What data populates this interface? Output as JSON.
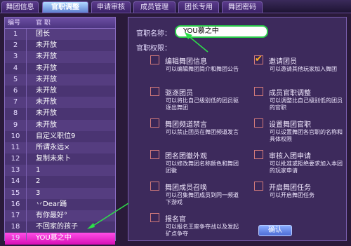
{
  "tabs": [
    {
      "label": "舞团信息"
    },
    {
      "label": "官职调整"
    },
    {
      "label": "申请审核"
    },
    {
      "label": "成员管理"
    },
    {
      "label": "团长专用"
    },
    {
      "label": "舞团密码"
    }
  ],
  "list": {
    "header_num": "编号",
    "header_name": "官 职",
    "rows": [
      {
        "num": "1",
        "name": "团长"
      },
      {
        "num": "2",
        "name": "未开放"
      },
      {
        "num": "3",
        "name": "未开放"
      },
      {
        "num": "4",
        "name": "未开放"
      },
      {
        "num": "5",
        "name": "未开放"
      },
      {
        "num": "6",
        "name": "未开放"
      },
      {
        "num": "7",
        "name": "未开放"
      },
      {
        "num": "8",
        "name": "未开放"
      },
      {
        "num": "9",
        "name": "未开放"
      },
      {
        "num": "10",
        "name": "自定义职位9"
      },
      {
        "num": "11",
        "name": "所谓永远×"
      },
      {
        "num": "12",
        "name": "复制未来卜"
      },
      {
        "num": "13",
        "name": "1"
      },
      {
        "num": "14",
        "name": "2"
      },
      {
        "num": "15",
        "name": "3"
      },
      {
        "num": "16",
        "name": "丷Dear踊"
      },
      {
        "num": "17",
        "name": "有你最好°"
      },
      {
        "num": "18",
        "name": "不回家的孩子"
      },
      {
        "num": "19",
        "name": "YOU慕之中"
      }
    ]
  },
  "form": {
    "name_label": "官职名称：",
    "name_value": "YOU慕之中",
    "perm_label": "官职权限：",
    "save_label": "确认"
  },
  "permissions": [
    {
      "title": "编辑舞团信息",
      "desc": "可以编辑舞团简介和舞团公告",
      "checked": false
    },
    {
      "title": "邀请团员",
      "desc": "可以邀请其他玩家加入舞团",
      "checked": true
    },
    {
      "title": "驱逐团员",
      "desc": "可以将比自己级别低的团员驱逐出舞团",
      "checked": false
    },
    {
      "title": "成员官职调整",
      "desc": "可以调整比自己级别低的团员的官职",
      "checked": false
    },
    {
      "title": "舞团频道禁言",
      "desc": "可以禁止团员在舞团频道发言",
      "checked": false
    },
    {
      "title": "设置舞团官职",
      "desc": "可以设置舞团各官职的名称和具体权限",
      "checked": false
    },
    {
      "title": "团名团徽外观",
      "desc": "可以修改舞团名称颜色和舞团团徽",
      "checked": false
    },
    {
      "title": "审核入团申请",
      "desc": "可以批准或拒绝要求加入本团的玩家申请",
      "checked": false
    },
    {
      "title": "舞团成员召唤",
      "desc": "可以召集舞团成员到同一频道下游戏",
      "checked": false
    },
    {
      "title": "开启舞团任务",
      "desc": "可以开启舞团任务",
      "checked": false
    },
    {
      "title": "报名官",
      "desc": "可以报名王座争夺战以及发起矿点争夺",
      "checked": false
    }
  ],
  "colors": {
    "selected_row": "#e21cc4",
    "input_border": "#29c94a",
    "check_mark": "#ffb020"
  }
}
